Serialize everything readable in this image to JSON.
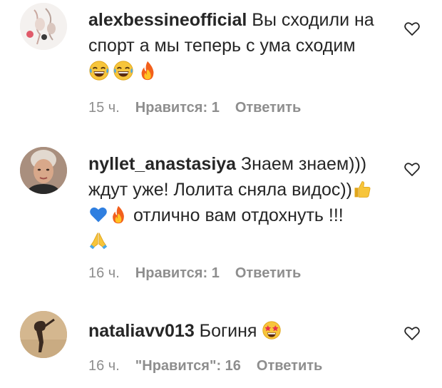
{
  "comments": [
    {
      "username": "alexbessineofficial",
      "text_line1": "Вы сходили на",
      "text_line2": "спорт а мы теперь с ума сходим",
      "emojis": [
        "grinning-tears-emoji",
        "grinning-tears-emoji",
        "fire-emoji"
      ],
      "time": "15 ч.",
      "likes": "Нравится: 1",
      "reply": "Ответить"
    },
    {
      "username": "nyllet_anastasiya",
      "text_line1": "Знаем знаем)))",
      "text_line2": "ждут уже! Лолита сняла видос))",
      "text_line3": "отлично вам отдохнуть !!!",
      "emojis": [
        "thumbs-up-emoji",
        "blue-heart-emoji",
        "fire-emoji",
        "folded-hands-emoji"
      ],
      "time": "16 ч.",
      "likes": "Нравится: 1",
      "reply": "Ответить"
    },
    {
      "username": "nataliavv013",
      "text_line1": "Богиня",
      "emojis": [
        "star-struck-emoji"
      ],
      "time": "16 ч.",
      "likes": "\"Нравится\": 16",
      "reply": "Ответить"
    }
  ],
  "colors": {
    "text": "#262626",
    "meta": "#8e8e8e"
  }
}
